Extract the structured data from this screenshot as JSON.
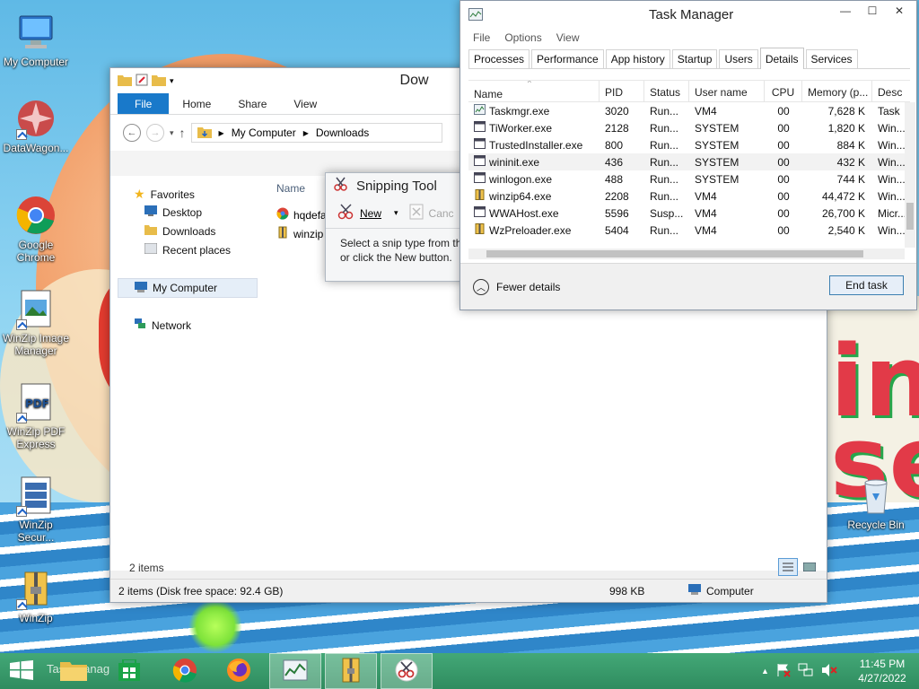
{
  "desktop": {
    "icons": [
      {
        "label": "My Computer"
      },
      {
        "label": "DataWagon..."
      },
      {
        "label": "Google Chrome"
      },
      {
        "label": "WinZip Image Manager"
      },
      {
        "label": "WinZip PDF Express"
      },
      {
        "label": "WinZip Secur..."
      },
      {
        "label": "WinZip"
      },
      {
        "label": "Recycle Bin"
      }
    ]
  },
  "explorer": {
    "title": "Dow",
    "ribbon_tabs": [
      "File",
      "Home",
      "Share",
      "View"
    ],
    "breadcrumb": [
      "My Computer",
      "Downloads"
    ],
    "nav": {
      "favorites": "Favorites",
      "desktop": "Desktop",
      "downloads": "Downloads",
      "recent": "Recent places",
      "my_computer": "My Computer",
      "network": "Network"
    },
    "column_name": "Name",
    "files": [
      "hqdefa",
      "winzip"
    ],
    "item_count": "2 items",
    "status_left": "2 items (Disk free space: 92.4 GB)",
    "status_size": "998 KB",
    "status_location": "Computer"
  },
  "snipping": {
    "title": "Snipping Tool",
    "new_label": "New",
    "cancel_label": "Canc",
    "message_line1": "Select a snip type from th",
    "message_line2": "or click the New button."
  },
  "taskmgr": {
    "title": "Task Manager",
    "menu": [
      "File",
      "Options",
      "View"
    ],
    "tabs": [
      "Processes",
      "Performance",
      "App history",
      "Startup",
      "Users",
      "Details",
      "Services"
    ],
    "active_tab": "Details",
    "columns": [
      "Name",
      "PID",
      "Status",
      "User name",
      "CPU",
      "Memory (p...",
      "Desc"
    ],
    "rows": [
      {
        "name": "Taskmgr.exe",
        "pid": "3020",
        "status": "Run...",
        "user": "VM4",
        "cpu": "00",
        "mem": "7,628 K",
        "desc": "Task"
      },
      {
        "name": "TiWorker.exe",
        "pid": "2128",
        "status": "Run...",
        "user": "SYSTEM",
        "cpu": "00",
        "mem": "1,820 K",
        "desc": "Win..."
      },
      {
        "name": "TrustedInstaller.exe",
        "pid": "800",
        "status": "Run...",
        "user": "SYSTEM",
        "cpu": "00",
        "mem": "884 K",
        "desc": "Win..."
      },
      {
        "name": "wininit.exe",
        "pid": "436",
        "status": "Run...",
        "user": "SYSTEM",
        "cpu": "00",
        "mem": "432 K",
        "desc": "Win..."
      },
      {
        "name": "winlogon.exe",
        "pid": "488",
        "status": "Run...",
        "user": "SYSTEM",
        "cpu": "00",
        "mem": "744 K",
        "desc": "Win..."
      },
      {
        "name": "winzip64.exe",
        "pid": "2208",
        "status": "Run...",
        "user": "VM4",
        "cpu": "00",
        "mem": "44,472 K",
        "desc": "Win..."
      },
      {
        "name": "WWAHost.exe",
        "pid": "5596",
        "status": "Susp...",
        "user": "VM4",
        "cpu": "00",
        "mem": "26,700 K",
        "desc": "Micr..."
      },
      {
        "name": "WzPreloader.exe",
        "pid": "5404",
        "status": "Run...",
        "user": "VM4",
        "cpu": "00",
        "mem": "2,540 K",
        "desc": "Win..."
      }
    ],
    "fewer_details": "Fewer details",
    "end_task": "End task"
  },
  "taskbar": {
    "search_text": "Task Manag",
    "time": "11:45 PM",
    "date": "4/27/2022"
  },
  "colors": {
    "accent": "#1979ca",
    "taskbar": "#3a9a6d"
  }
}
